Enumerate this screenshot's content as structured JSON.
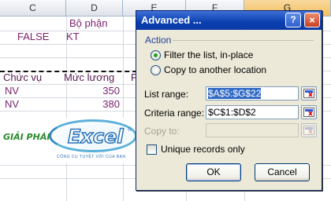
{
  "sheet": {
    "columns": [
      "C",
      "D",
      "E",
      "F",
      "G"
    ],
    "selected_column": "G",
    "cells": {
      "d1": "Bộ phận",
      "c2": "FALSE",
      "d2": "KT",
      "b4": "Chức vụ",
      "c4": "Mức lương",
      "d4_partial": "P",
      "a5": "NV",
      "b5": "350",
      "a6": "NV",
      "b6": "380"
    }
  },
  "logo": {
    "left_text": "GIẢI PHÁP",
    "word": "Excel",
    "tagline": "CÔNG CỤ TUYỆT VỜI CỦA BẠN",
    "reg": "®"
  },
  "dialog": {
    "title": "Advanced ...",
    "help_label": "?",
    "close_label": "×",
    "action_group": "Action",
    "radio_filter": "Filter the list, in-place",
    "radio_copy": "Copy to another location",
    "list_range_label": "List range:",
    "list_range_value": "$A$5:$G$22",
    "criteria_range_label": "Criteria range:",
    "criteria_range_value": "$C$1:$D$2",
    "copy_to_label": "Copy to:",
    "copy_to_value": "",
    "unique_label": "Unique records only",
    "ok_label": "OK",
    "cancel_label": "Cancel",
    "filter_selected": true,
    "unique_checked": false
  },
  "colors": {
    "title_bar": "#0a3fb0",
    "selected_column": "#f1c15f",
    "cell_text": "#7a1f6e"
  }
}
